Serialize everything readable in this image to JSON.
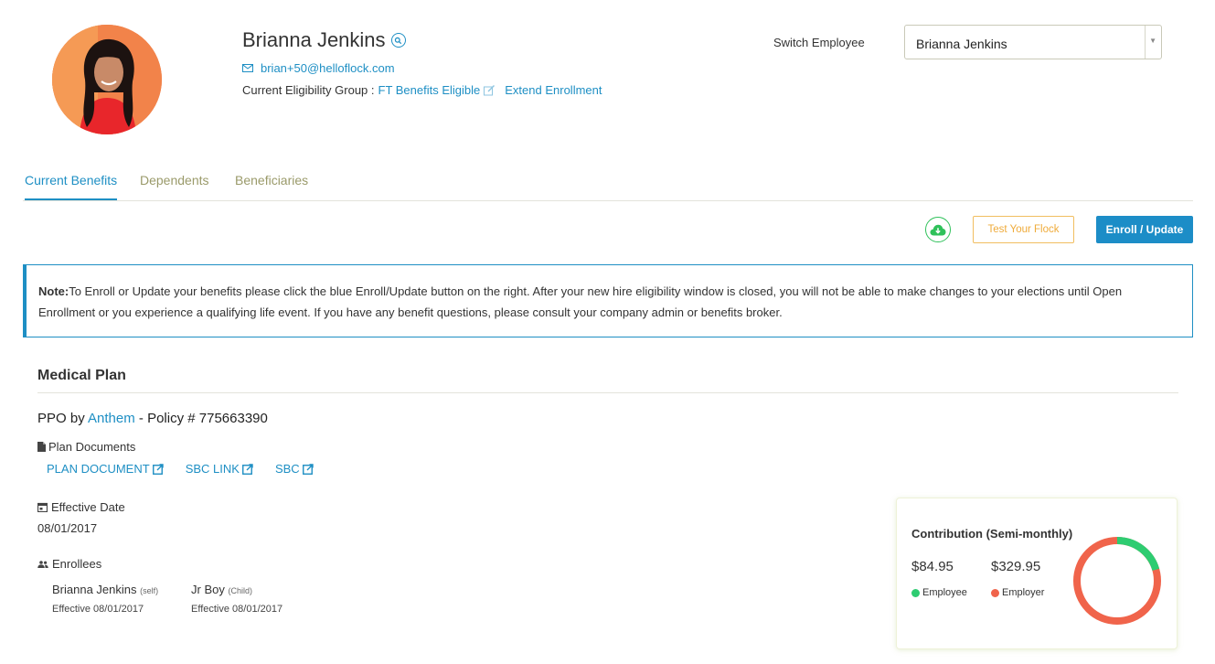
{
  "profile": {
    "name": "Brianna Jenkins",
    "email": "brian+50@helloflock.com",
    "eligibility_label": "Current Eligibility Group :",
    "eligibility_group": "FT Benefits Eligible",
    "extend_enrollment": "Extend Enrollment"
  },
  "switch_employee": {
    "label": "Switch Employee",
    "selected": "Brianna Jenkins"
  },
  "tabs": [
    {
      "label": "Current Benefits",
      "active": true
    },
    {
      "label": "Dependents",
      "active": false
    },
    {
      "label": "Beneficiaries",
      "active": false
    }
  ],
  "actions": {
    "test_label": "Test Your Flock",
    "enroll_label": "Enroll / Update",
    "download_icon": "cloud-download-icon"
  },
  "note": {
    "prefix": "Note:",
    "text": "To Enroll or Update your benefits please click the blue Enroll/Update button on the right. After your new hire eligibility window is closed, you will not be able to make changes to your elections until Open Enrollment or you experience a qualifying life event. If you have any benefit questions, please consult your company admin or benefits broker."
  },
  "medical_plan": {
    "title": "Medical Plan",
    "plan_type": "PPO",
    "by": "by",
    "carrier": "Anthem",
    "policy_text": "- Policy # 775663390",
    "documents_label": "Plan Documents",
    "documents": [
      "PLAN DOCUMENT",
      "SBC LINK",
      "SBC"
    ],
    "effective_label": "Effective Date",
    "effective_date": "08/01/2017",
    "enrollees_label": "Enrollees",
    "enrollees": [
      {
        "name": "Brianna Jenkins",
        "relation": "(self)",
        "effective": "Effective 08/01/2017"
      },
      {
        "name": "Jr Boy",
        "relation": "(Child)",
        "effective": "Effective 08/01/2017"
      }
    ]
  },
  "contribution": {
    "title": "Contribution (Semi-monthly)",
    "employee_amount": "$84.95",
    "employer_amount": "$329.95",
    "employee_label": "Employee",
    "employer_label": "Employer",
    "employee_value": 84.95,
    "employer_value": 329.95,
    "employee_color": "#2ecc71",
    "employer_color": "#f0644b"
  },
  "colors": {
    "accent": "#1e8fc4",
    "warning": "#efab3a",
    "success": "#2fc15a"
  }
}
